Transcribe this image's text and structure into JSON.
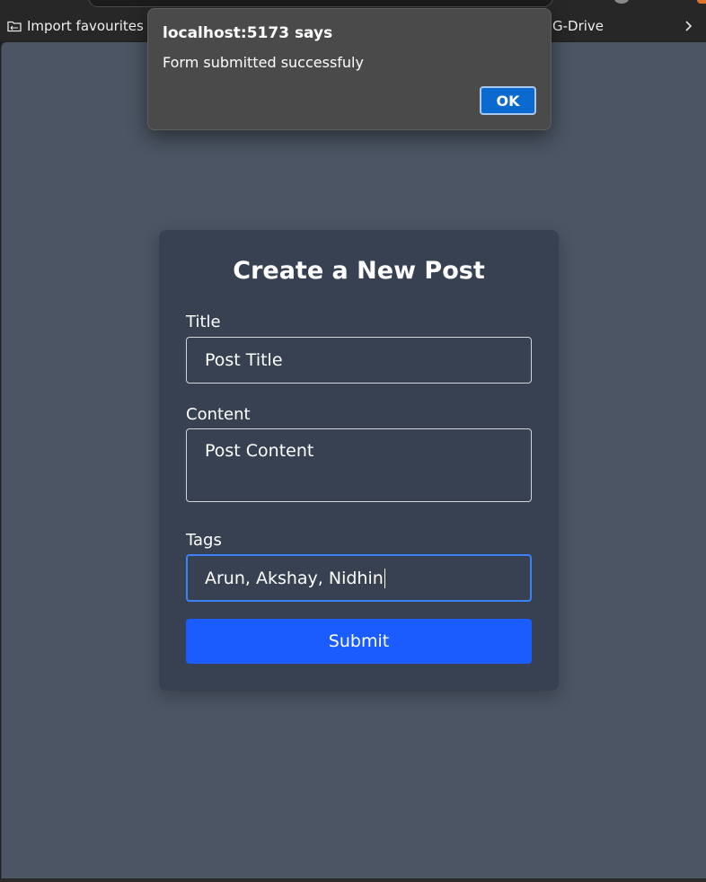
{
  "bookmarks": {
    "import_label": "Import favourites",
    "gdrive_label": "G-Drive"
  },
  "dialog": {
    "title": "localhost:5173 says",
    "message": "Form submitted successfuly",
    "ok_label": "OK"
  },
  "form": {
    "heading": "Create a New Post",
    "title_label": "Title",
    "title_value": "Post Title",
    "content_label": "Content",
    "content_value": "Post Content",
    "tags_label": "Tags",
    "tags_value": "Arun, Akshay, Nidhin",
    "submit_label": "Submit"
  },
  "colors": {
    "page_bg": "#4b5563",
    "card_bg": "#374151",
    "submit_bg": "#1a5cff",
    "focus_ring": "#3b82f6",
    "dialog_bg": "#4a4a4a",
    "ok_bg": "#0b6ad0"
  },
  "icons": {
    "bookmark_folder": "folder-icon",
    "bookmark_overflow": "chevron-right-icon"
  }
}
